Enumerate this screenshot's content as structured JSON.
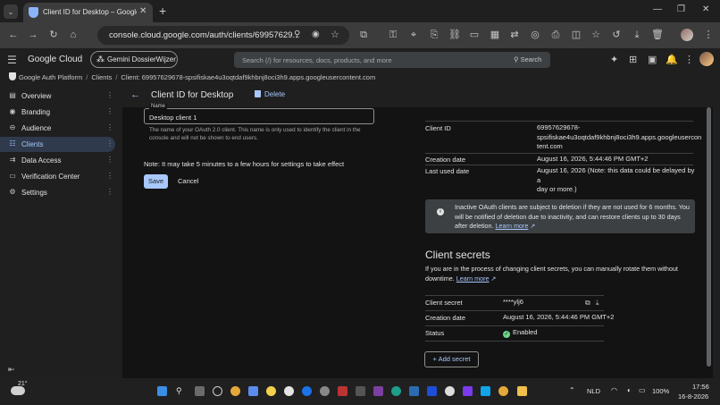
{
  "browser": {
    "tab_title": "Client ID for Desktop – Google",
    "url": "console.cloud.google.com/auth/clients/69957629...",
    "icons": [
      "tab-search-icon",
      "back-icon",
      "forward-icon",
      "reload-icon",
      "home-icon",
      "zoom-icon",
      "eye-off-icon",
      "star-icon",
      "extensions-icon",
      "key-icon",
      "location-icon",
      "menu-icon"
    ]
  },
  "header": {
    "product": "Google Cloud",
    "project": "Gemini DossierWijzer",
    "search_placeholder": "Search (/) for resources, docs, products, and more",
    "search_button": "Search"
  },
  "breadcrumb": {
    "items": [
      "Google Auth Platform",
      "Clients",
      "Client: 69957629678-spsifiskae4u3oqtdaf9khbnj8oci3h9.apps.googleusercontent.com"
    ],
    "separator": "/"
  },
  "sidebar": {
    "items": [
      {
        "label": "Overview",
        "icon": "overview-icon"
      },
      {
        "label": "Branding",
        "icon": "branding-icon"
      },
      {
        "label": "Audience",
        "icon": "audience-icon"
      },
      {
        "label": "Clients",
        "icon": "clients-icon",
        "active": true
      },
      {
        "label": "Data Access",
        "icon": "data-access-icon"
      },
      {
        "label": "Verification Center",
        "icon": "verification-icon"
      },
      {
        "label": "Settings",
        "icon": "settings-icon"
      }
    ]
  },
  "main": {
    "title": "Client ID for Desktop",
    "delete_label": "Delete",
    "name_label": "Name",
    "name_value": "Desktop client 1",
    "name_help": "The name of your OAuth 2.0 client. This name is only used to identify the client in the console and will not be shown to end users.",
    "note": "Note: It may take 5 minutes to a few hours for settings to take effect",
    "save_label": "Save",
    "cancel_label": "Cancel"
  },
  "client_info": {
    "client_id_label": "Client ID",
    "client_id_line1": "69957629678-",
    "client_id_line2": "spsifiskae4u3oqtdaf9khbnj8oci3h9.apps.googleusercon",
    "client_id_line3": "tent.com",
    "creation_label": "Creation date",
    "creation_value": "August 16, 2026, 5:44:46 PM GMT+2",
    "last_used_label": "Last used date",
    "last_used_line1": "August 16, 2026 (Note: this data could be delayed by a",
    "last_used_line2": "day or more.)"
  },
  "notice": {
    "line1": "Inactive OAuth clients are subject to deletion if they are not used for 6 months. You",
    "line2": "will be notified of deletion due to inactivity, and can restore clients up to 30 days",
    "line3_prefix": "after deletion. ",
    "link": "Learn more"
  },
  "secrets": {
    "title": "Client secrets",
    "desc_line1": "If you are in the process of changing client secrets, you can manually rotate them without",
    "desc_prefix": "downtime. ",
    "desc_link": "Learn more",
    "secret_label": "Client secret",
    "secret_value": "****ylj6",
    "creation_label": "Creation date",
    "creation_value": "August 16, 2026, 5:44:46 PM GMT+2",
    "status_label": "Status",
    "status_value": "Enabled",
    "add_label": "Add secret"
  },
  "taskbar": {
    "temperature": "21°",
    "language": "NLD",
    "battery": "100%",
    "time": "17:56",
    "date": "16-8-2026"
  },
  "colors": {
    "accent": "#a8c7fa",
    "enabled": "#6dd58c",
    "background": "#131314"
  }
}
